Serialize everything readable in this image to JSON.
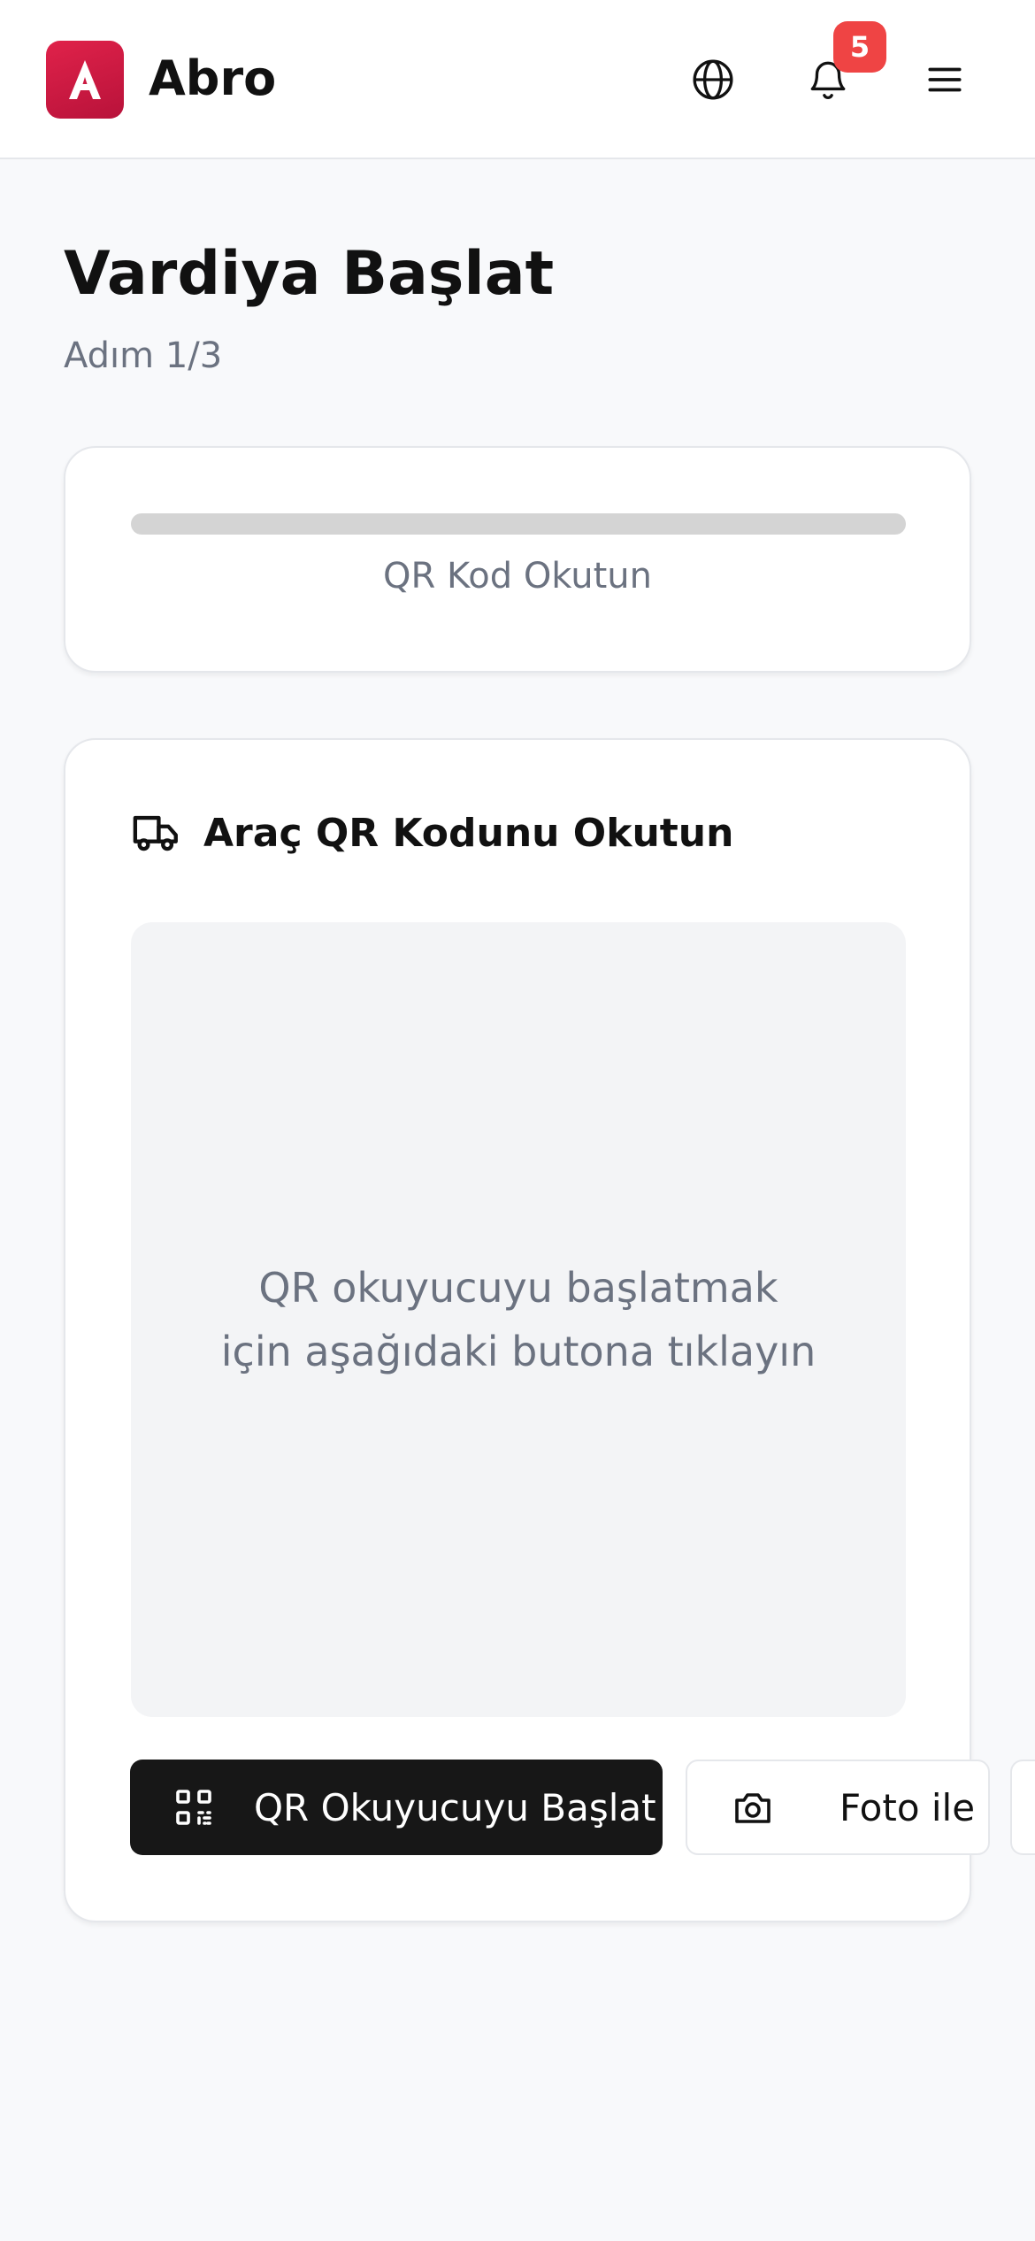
{
  "header": {
    "app_name": "Abro",
    "logo_letter": "A",
    "notification_count": "5",
    "icons": [
      "globe-icon",
      "bell-icon",
      "menu-icon"
    ]
  },
  "page": {
    "title": "Vardiya Başlat",
    "step": "Adım 1/3"
  },
  "progress": {
    "value": 0,
    "label": "QR Kod Okutun"
  },
  "scan_card": {
    "title": "Araç QR Kodunu Okutun",
    "icon": "truck-icon",
    "placeholder": "QR okuyucuyu başlatmak için aşağıdaki butona tıklayın",
    "primary_button": "QR Okuyucuyu Başlat",
    "secondary_button": "Foto ile"
  },
  "colors": {
    "brand": "#d91a44",
    "badge": "#ef4444",
    "primary_button": "#171717"
  }
}
